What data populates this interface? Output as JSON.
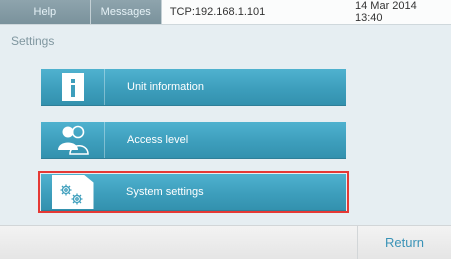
{
  "topbar": {
    "tabs": [
      {
        "label": "Help"
      },
      {
        "label": "Messages"
      }
    ],
    "connection": "TCP:192.168.1.101",
    "datetime": "14 Mar 2014 13:40"
  },
  "page": {
    "title": "Settings"
  },
  "menu": {
    "items": [
      {
        "label": "Unit information",
        "icon": "info-icon"
      },
      {
        "label": "Access level",
        "icon": "users-icon"
      },
      {
        "label": "System settings",
        "icon": "gears-icon",
        "selected": true
      }
    ]
  },
  "bottombar": {
    "return_label": "Return"
  },
  "colors": {
    "accent": "#3d9ebc",
    "selection": "#e53935",
    "link": "#3a93b7"
  }
}
